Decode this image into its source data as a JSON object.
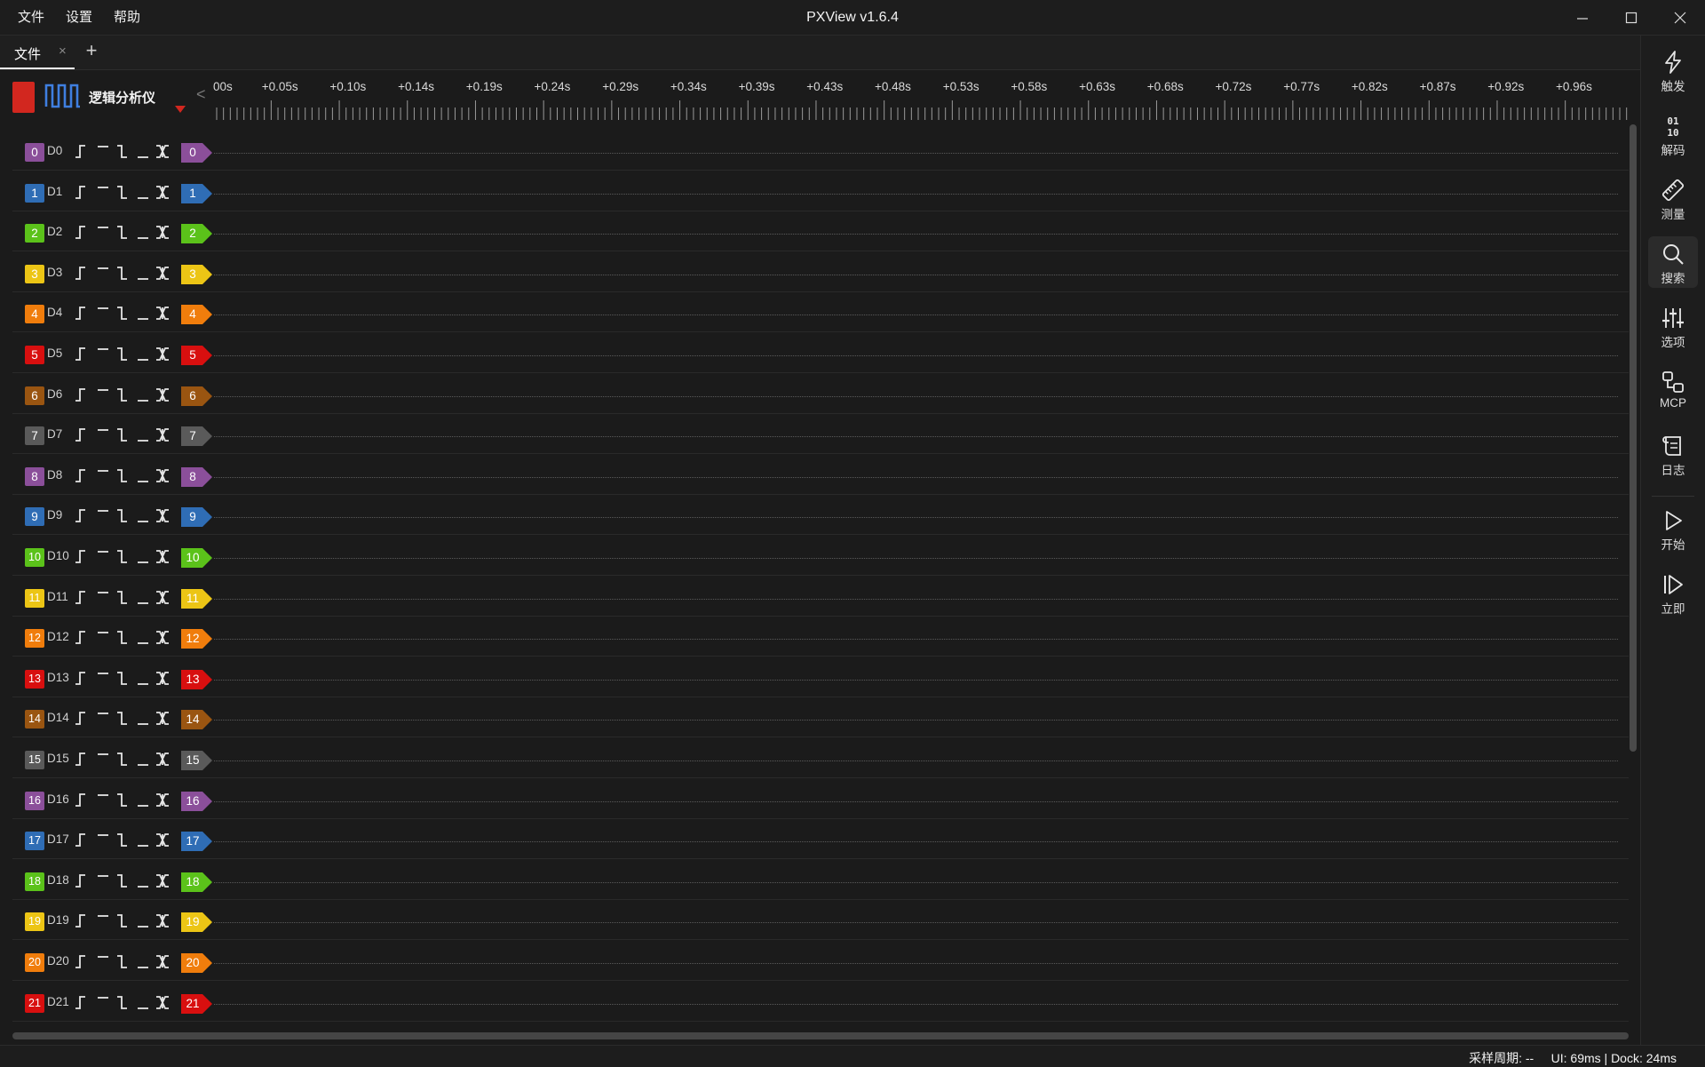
{
  "menu": [
    "文件",
    "设置",
    "帮助"
  ],
  "app_title": "PXView v1.6.4",
  "tab": {
    "label": "文件",
    "close": "×",
    "add": "+"
  },
  "device": {
    "name": "逻辑分析仪",
    "collapse": "<",
    "run_color": "#d2271f"
  },
  "ruler_ticks": [
    "00s",
    "+0.05s",
    "+0.10s",
    "+0.14s",
    "+0.19s",
    "+0.24s",
    "+0.29s",
    "+0.34s",
    "+0.39s",
    "+0.43s",
    "+0.48s",
    "+0.53s",
    "+0.58s",
    "+0.63s",
    "+0.68s",
    "+0.72s",
    "+0.77s",
    "+0.82s",
    "+0.87s",
    "+0.92s",
    "+0.96s"
  ],
  "channel_palette": [
    "#8b4f9a",
    "#2f6db5",
    "#5bc21a",
    "#ecc515",
    "#f07d0c",
    "#d80f0f",
    "#9a5511",
    "#5a5a5a"
  ],
  "channels": [
    {
      "num": "0",
      "name": "D0"
    },
    {
      "num": "1",
      "name": "D1"
    },
    {
      "num": "2",
      "name": "D2"
    },
    {
      "num": "3",
      "name": "D3"
    },
    {
      "num": "4",
      "name": "D4"
    },
    {
      "num": "5",
      "name": "D5"
    },
    {
      "num": "6",
      "name": "D6"
    },
    {
      "num": "7",
      "name": "D7"
    },
    {
      "num": "8",
      "name": "D8"
    },
    {
      "num": "9",
      "name": "D9"
    },
    {
      "num": "10",
      "name": "D10"
    },
    {
      "num": "11",
      "name": "D11"
    },
    {
      "num": "12",
      "name": "D12"
    },
    {
      "num": "13",
      "name": "D13"
    },
    {
      "num": "14",
      "name": "D14"
    },
    {
      "num": "15",
      "name": "D15"
    },
    {
      "num": "16",
      "name": "D16"
    },
    {
      "num": "17",
      "name": "D17"
    },
    {
      "num": "18",
      "name": "D18"
    },
    {
      "num": "19",
      "name": "D19"
    },
    {
      "num": "20",
      "name": "D20"
    },
    {
      "num": "21",
      "name": "D21"
    }
  ],
  "dock": [
    {
      "label": "触发",
      "icon": "lightning-icon"
    },
    {
      "label": "解码",
      "icon": "binary-icon"
    },
    {
      "label": "测量",
      "icon": "ruler-icon"
    },
    {
      "label": "搜索",
      "icon": "search-icon",
      "active": true
    },
    {
      "label": "选项",
      "icon": "sliders-icon"
    },
    {
      "label": "MCP",
      "icon": "mcp-icon"
    },
    {
      "label": "日志",
      "icon": "scroll-icon"
    },
    {
      "label": "开始",
      "icon": "play-icon"
    },
    {
      "label": "立即",
      "icon": "play-once-icon"
    }
  ],
  "status": "采样周期: --     UI: 69ms | Dock: 24ms"
}
